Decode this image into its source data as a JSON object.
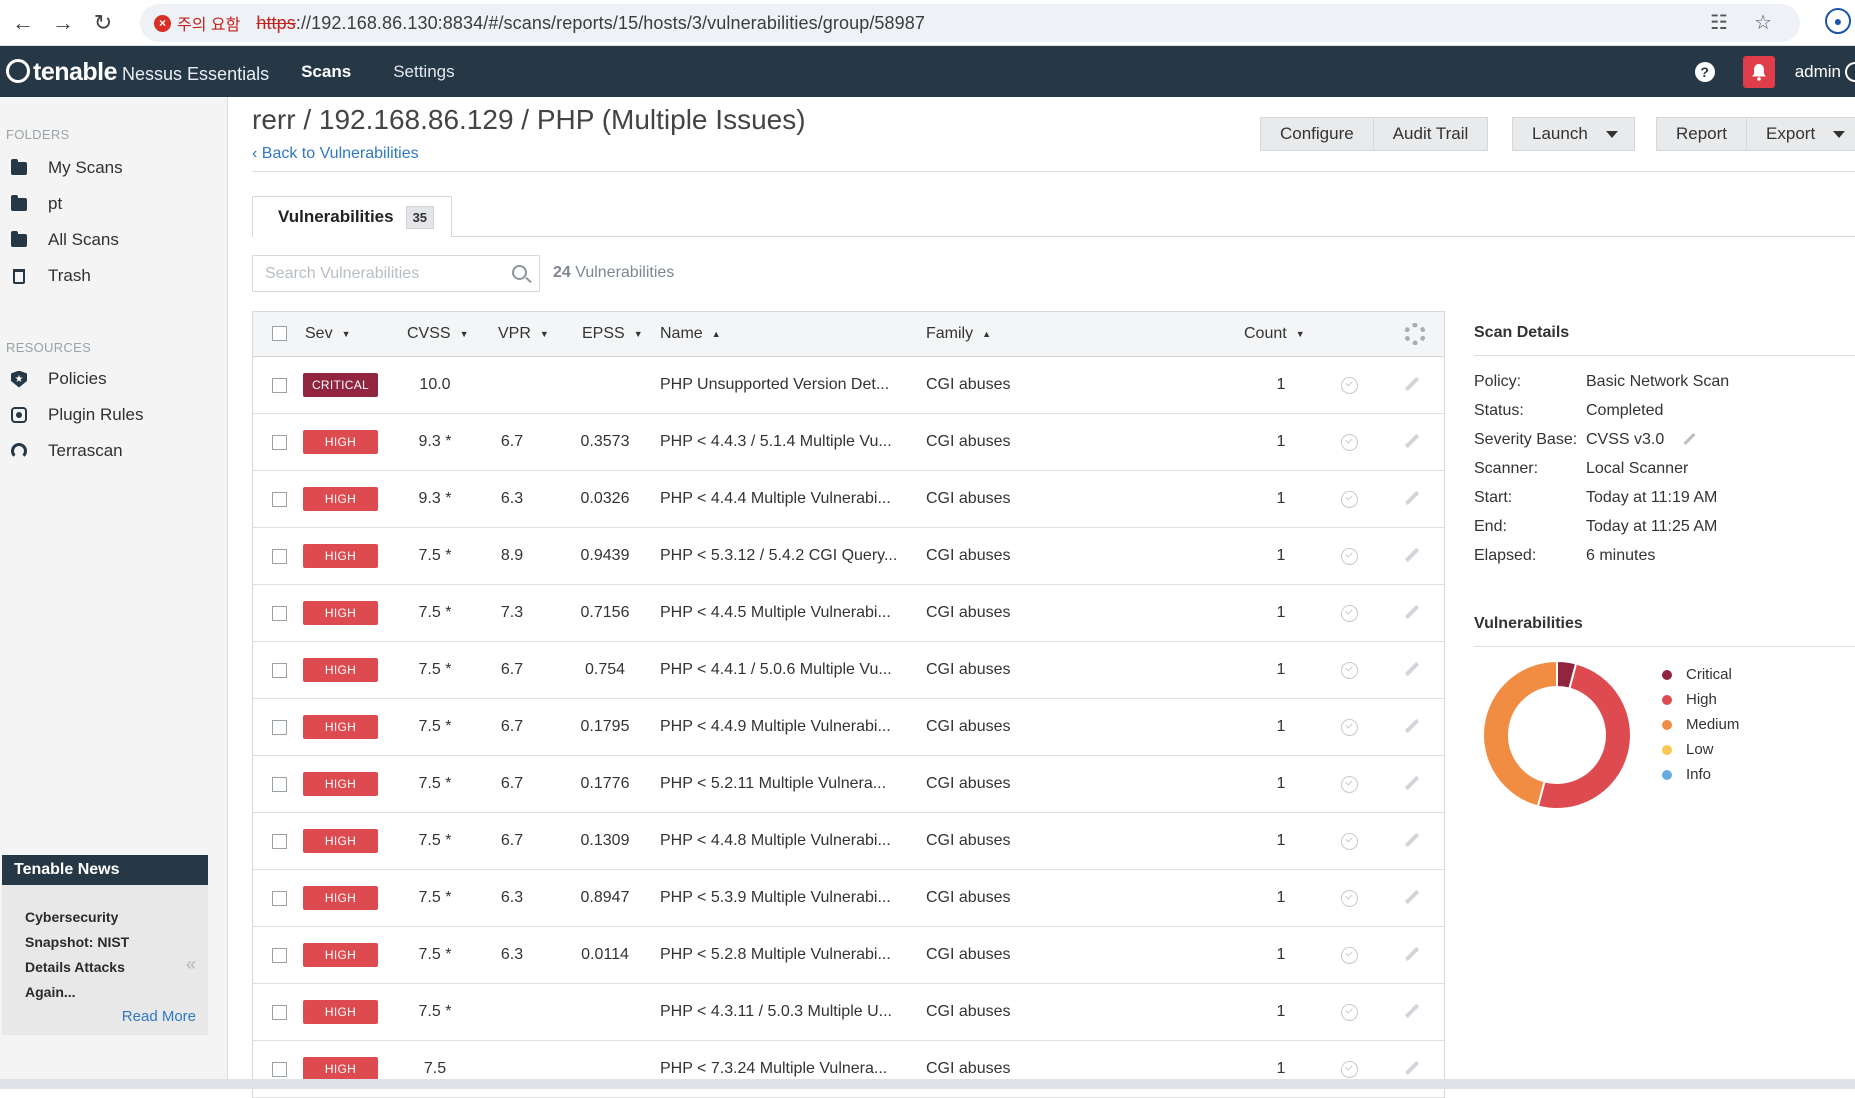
{
  "browser": {
    "warning": "주의 요함",
    "url_scheme": "https",
    "url_rest": "://192.168.86.130:8834/#/scans/reports/15/hosts/3/vulnerabilities/group/58987"
  },
  "topnav": {
    "brand": "tenable",
    "product": "Nessus Essentials",
    "links": [
      "Scans",
      "Settings"
    ],
    "help": "?",
    "user": "admin"
  },
  "sidebar": {
    "folders_heading": "FOLDERS",
    "folders": [
      "My Scans",
      "pt",
      "All Scans",
      "Trash"
    ],
    "resources_heading": "RESOURCES",
    "resources": [
      "Policies",
      "Plugin Rules",
      "Terrascan"
    ]
  },
  "news": {
    "title": "Tenable News",
    "headline": "Cybersecurity Snapshot: NIST Details Attacks Again...",
    "read_more": "Read More"
  },
  "header": {
    "title": "rerr / 192.168.86.129 / PHP (Multiple Issues)",
    "back": "Back to Vulnerabilities",
    "buttons": {
      "configure": "Configure",
      "audit_trail": "Audit Trail",
      "launch": "Launch",
      "report": "Report",
      "export": "Export"
    }
  },
  "tab": {
    "label": "Vulnerabilities",
    "count": "35"
  },
  "search": {
    "placeholder": "Search Vulnerabilities"
  },
  "count_text": {
    "number": "24",
    "label": "Vulnerabilities"
  },
  "table": {
    "headers": {
      "sev": "Sev",
      "cvss": "CVSS",
      "vpr": "VPR",
      "epss": "EPSS",
      "name": "Name",
      "family": "Family",
      "count": "Count"
    },
    "rows": [
      {
        "sev": "CRITICAL",
        "cvss": "10.0",
        "vpr": "",
        "epss": "",
        "name": "PHP Unsupported Version Det...",
        "family": "CGI abuses",
        "count": "1"
      },
      {
        "sev": "HIGH",
        "cvss": "9.3 *",
        "vpr": "6.7",
        "epss": "0.3573",
        "name": "PHP < 4.4.3 / 5.1.4 Multiple Vu...",
        "family": "CGI abuses",
        "count": "1"
      },
      {
        "sev": "HIGH",
        "cvss": "9.3 *",
        "vpr": "6.3",
        "epss": "0.0326",
        "name": "PHP < 4.4.4 Multiple Vulnerabi...",
        "family": "CGI abuses",
        "count": "1"
      },
      {
        "sev": "HIGH",
        "cvss": "7.5 *",
        "vpr": "8.9",
        "epss": "0.9439",
        "name": "PHP < 5.3.12 / 5.4.2 CGI Query...",
        "family": "CGI abuses",
        "count": "1"
      },
      {
        "sev": "HIGH",
        "cvss": "7.5 *",
        "vpr": "7.3",
        "epss": "0.7156",
        "name": "PHP < 4.4.5 Multiple Vulnerabi...",
        "family": "CGI abuses",
        "count": "1"
      },
      {
        "sev": "HIGH",
        "cvss": "7.5 *",
        "vpr": "6.7",
        "epss": "0.754",
        "name": "PHP < 4.4.1 / 5.0.6 Multiple Vu...",
        "family": "CGI abuses",
        "count": "1"
      },
      {
        "sev": "HIGH",
        "cvss": "7.5 *",
        "vpr": "6.7",
        "epss": "0.1795",
        "name": "PHP < 4.4.9 Multiple Vulnerabi...",
        "family": "CGI abuses",
        "count": "1"
      },
      {
        "sev": "HIGH",
        "cvss": "7.5 *",
        "vpr": "6.7",
        "epss": "0.1776",
        "name": "PHP < 5.2.11 Multiple Vulnera...",
        "family": "CGI abuses",
        "count": "1"
      },
      {
        "sev": "HIGH",
        "cvss": "7.5 *",
        "vpr": "6.7",
        "epss": "0.1309",
        "name": "PHP < 4.4.8 Multiple Vulnerabi...",
        "family": "CGI abuses",
        "count": "1"
      },
      {
        "sev": "HIGH",
        "cvss": "7.5 *",
        "vpr": "6.3",
        "epss": "0.8947",
        "name": "PHP < 5.3.9 Multiple Vulnerabi...",
        "family": "CGI abuses",
        "count": "1"
      },
      {
        "sev": "HIGH",
        "cvss": "7.5 *",
        "vpr": "6.3",
        "epss": "0.0114",
        "name": "PHP < 5.2.8 Multiple Vulnerabi...",
        "family": "CGI abuses",
        "count": "1"
      },
      {
        "sev": "HIGH",
        "cvss": "7.5 *",
        "vpr": "",
        "epss": "",
        "name": "PHP < 4.3.11 / 5.0.3 Multiple U...",
        "family": "CGI abuses",
        "count": "1"
      },
      {
        "sev": "HIGH",
        "cvss": "7.5",
        "vpr": "",
        "epss": "",
        "name": "PHP < 7.3.24 Multiple Vulnera...",
        "family": "CGI abuses",
        "count": "1"
      }
    ]
  },
  "scan_details": {
    "title": "Scan Details",
    "rows": [
      {
        "label": "Policy:",
        "value": "Basic Network Scan"
      },
      {
        "label": "Status:",
        "value": "Completed"
      },
      {
        "label": "Severity Base:",
        "value": "CVSS v3.0"
      },
      {
        "label": "Scanner:",
        "value": "Local Scanner"
      },
      {
        "label": "Start:",
        "value": "Today at 11:19 AM"
      },
      {
        "label": "End:",
        "value": "Today at 11:25 AM"
      },
      {
        "label": "Elapsed:",
        "value": "6 minutes"
      }
    ]
  },
  "vuln_chart": {
    "title": "Vulnerabilities",
    "legend": [
      {
        "label": "Critical",
        "color": "#91243e"
      },
      {
        "label": "High",
        "color": "#dd4b50"
      },
      {
        "label": "Medium",
        "color": "#f18c43"
      },
      {
        "label": "Low",
        "color": "#f8c851"
      },
      {
        "label": "Info",
        "color": "#67acdf"
      }
    ]
  },
  "chart_data": {
    "type": "pie",
    "categories": [
      "Critical",
      "High",
      "Medium",
      "Low",
      "Info"
    ],
    "values": [
      1,
      12,
      11,
      0,
      0
    ],
    "title": "Vulnerabilities"
  },
  "colors": {
    "critical": "#91243e",
    "high": "#dd4b50",
    "nav": "#263746",
    "link": "#2f78c4"
  }
}
